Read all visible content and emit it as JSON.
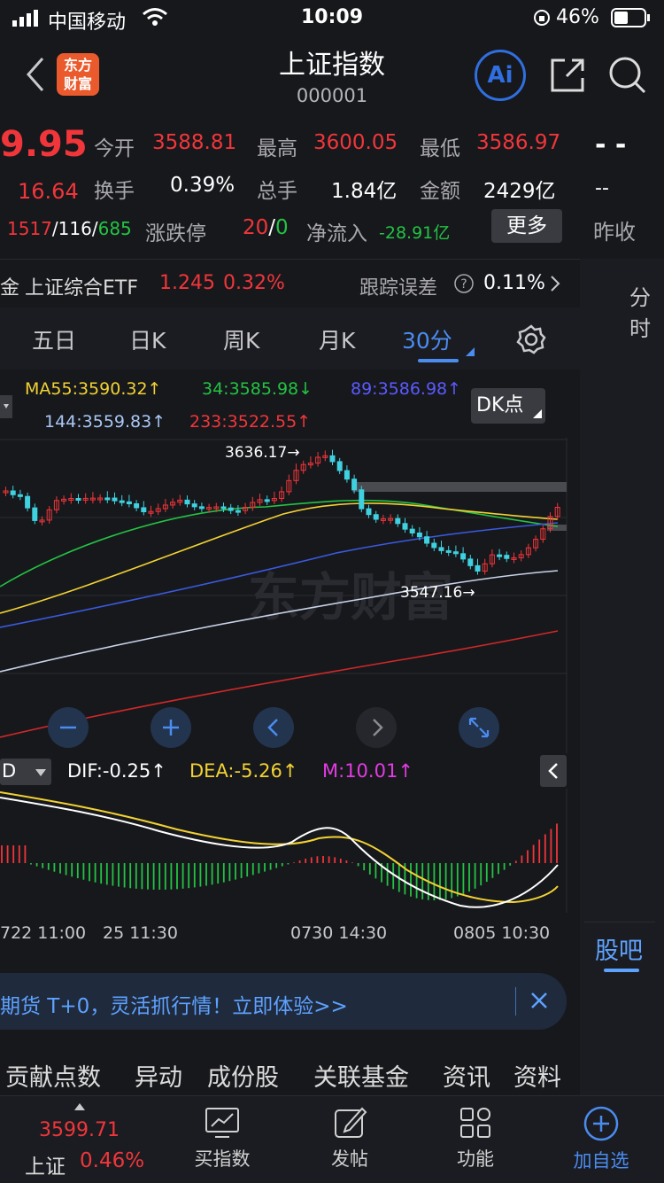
{
  "status": {
    "carrier": "中国移动",
    "time": "10:09",
    "battery": "46%"
  },
  "nav": {
    "logo_text_1": "东方",
    "logo_text_2": "财富",
    "title": "上证指数",
    "code": "000001",
    "ai_label": "Ai"
  },
  "quote": {
    "price": "9.95",
    "change": "16.64",
    "open_label": "今开",
    "open": "3588.81",
    "high_label": "最高",
    "high": "3600.05",
    "low_label": "最低",
    "low": "3586.97",
    "turnover_label": "换手",
    "turnover": "0.39%",
    "volume_label": "总手",
    "volume": "1.84亿",
    "amount_label": "金额",
    "amount": "2429亿",
    "adv": "1517",
    "flat": "116",
    "dec": "685",
    "limit_label": "涨跌停",
    "limit_up": "20",
    "limit_down": "0",
    "inflow_label": "净流入",
    "inflow": "-28.91亿",
    "more_label": "更多",
    "right_dash_1": "- -",
    "right_dash_2": "--",
    "prev_close_label": "昨收"
  },
  "etf": {
    "prefix": "金",
    "name": "上证综合ETF",
    "price": "1.245",
    "pct": "0.32%",
    "err_label": "跟踪误差",
    "err": "0.11%"
  },
  "tabs": [
    {
      "label": "五日"
    },
    {
      "label": "日K"
    },
    {
      "label": "周K"
    },
    {
      "label": "月K"
    },
    {
      "label": "30分"
    }
  ],
  "ma": {
    "ma55": "MA55:3590.32",
    "ma34": "34:3585.98",
    "ma89": "89:3586.98",
    "ma144": "144:3559.83",
    "ma233": "233:3522.55",
    "dk_label": "DK点"
  },
  "chart_annot": {
    "high": "3636.17",
    "low": "3547.16",
    "watermark": "东方财富"
  },
  "macd": {
    "prefix": "D",
    "dif": "DIF:-0.25",
    "dea": "DEA:-5.26",
    "m": "M:10.01"
  },
  "xaxis": {
    "t1": "722 11:00",
    "t2": "25 11:30",
    "t3": "0730 14:30",
    "t4": "0805 10:30"
  },
  "banner": {
    "text": "期货 T+0，灵活抓行情！立即体验>>"
  },
  "subtabs": [
    {
      "label": "贡献点数"
    },
    {
      "label": "异动"
    },
    {
      "label": "成份股"
    },
    {
      "label": "关联基金"
    },
    {
      "label": "资讯"
    },
    {
      "label": "资料"
    }
  ],
  "right": {
    "top_label": "分时",
    "guba": "股吧"
  },
  "bottom": {
    "index_price": "3599.71",
    "index_name": "上证",
    "index_pct": "0.46%",
    "buy": "买指数",
    "post": "发帖",
    "func": "功能",
    "add": "加自选"
  },
  "colors": {
    "red": "#f0363a",
    "green": "#23c343",
    "blue": "#2d6fd6",
    "yellow": "#f2d233",
    "purple": "#5a5aff"
  }
}
